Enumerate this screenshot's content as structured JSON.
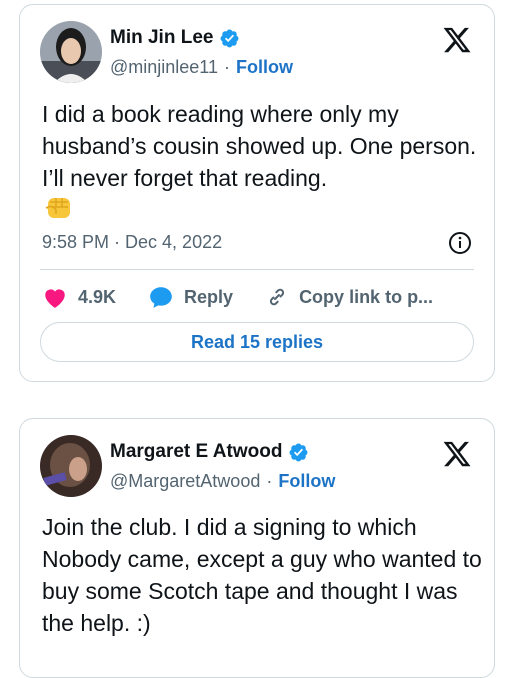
{
  "tweets": [
    {
      "display_name": "Min Jin Lee",
      "handle": "@minjinlee11",
      "separator": "·",
      "follow_label": "Follow",
      "text": "I did a book reading where only my husband’s cousin showed up. One person. I’ll never forget that reading.",
      "emoji": "✊",
      "time": "9:58 PM · Dec 4, 2022",
      "likes": "4.9K",
      "reply_label": "Reply",
      "copy_label": "Copy link to p...",
      "read_replies_label": "Read 15 replies"
    },
    {
      "display_name": "Margaret E Atwood",
      "handle": "@MargaretAtwood",
      "separator": "·",
      "follow_label": "Follow",
      "text": "Join the club. I did a signing to which Nobody came, except a guy who wanted to buy some Scotch tape and thought I was the help. :)"
    }
  ],
  "colors": {
    "verified": "#1d9bf0",
    "link": "#1d74c7",
    "like": "#f91880",
    "reply": "#1d9bf0"
  },
  "icons": [
    "verified-badge-icon",
    "x-logo-icon",
    "info-icon",
    "heart-icon",
    "reply-bubble-icon",
    "link-icon"
  ]
}
